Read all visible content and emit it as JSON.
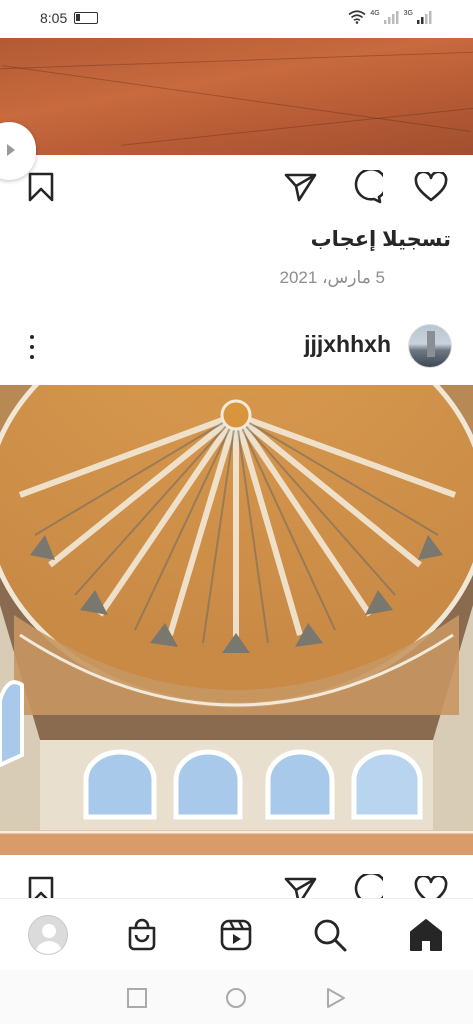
{
  "status_bar": {
    "time": "8:05",
    "network_1": "4G",
    "network_2": "3G"
  },
  "post_previous": {
    "likes_text": "تسجيلا إعجاب",
    "date_text": "5 مارس، 2021"
  },
  "post_current": {
    "username": "jjjxhhxh"
  },
  "icons": {
    "like": "heart-icon",
    "comment": "comment-icon",
    "share": "send-icon",
    "save": "bookmark-icon",
    "more": "more-vertical-icon",
    "home": "home-icon",
    "search": "search-icon",
    "reels": "reels-icon",
    "shop": "shop-bag-icon",
    "profile": "profile-avatar-icon"
  },
  "colors": {
    "icon": "#262626",
    "secondary_text": "#8e8e8e",
    "background": "#ffffff"
  }
}
